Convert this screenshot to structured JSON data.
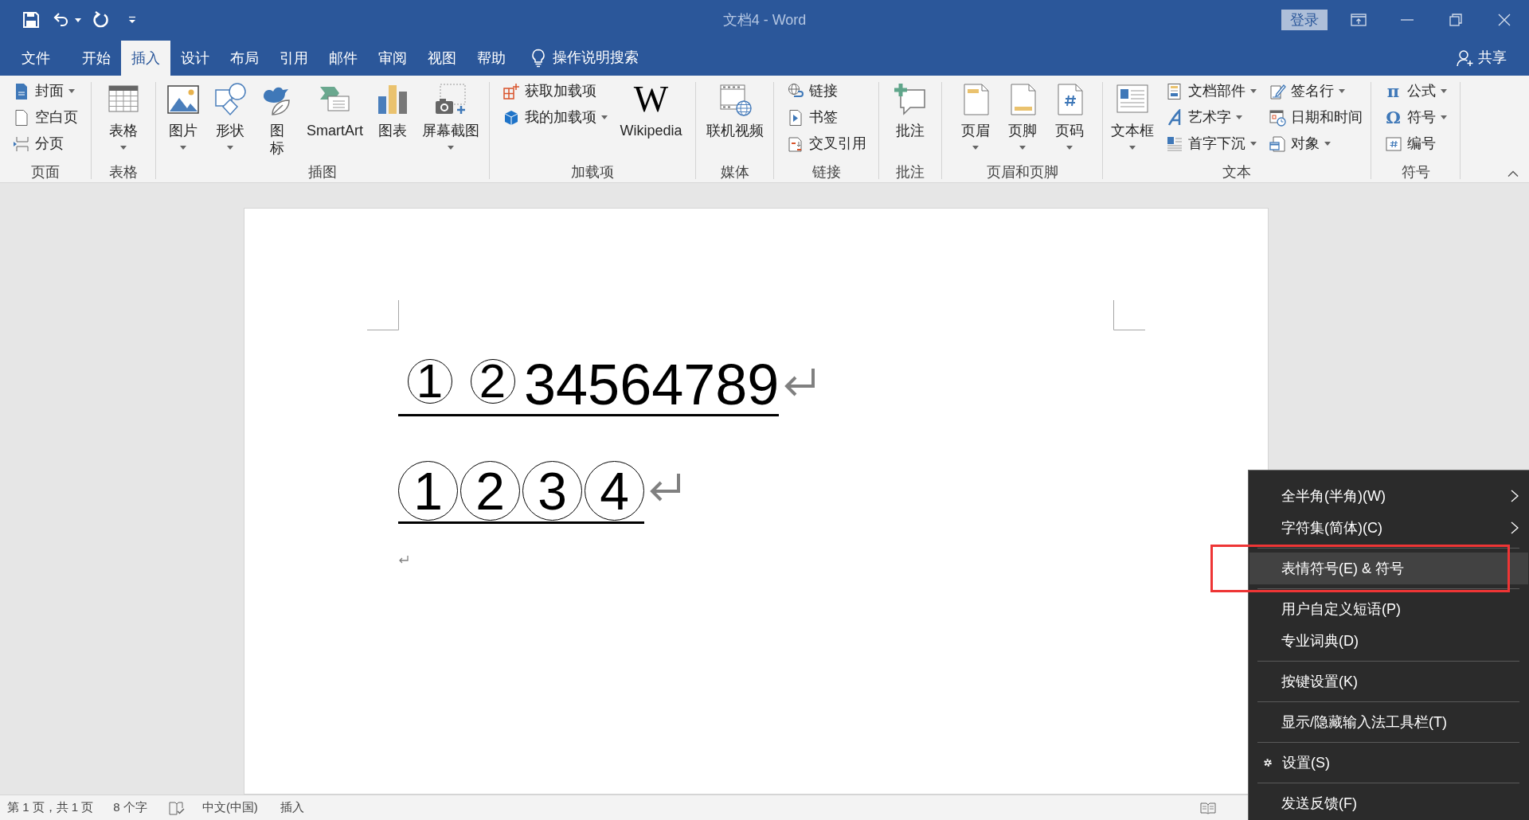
{
  "window": {
    "title": "文档4 - Word",
    "sign_in": "登录"
  },
  "tabs": [
    {
      "label": "文件",
      "selected": false
    },
    {
      "label": "开始",
      "selected": false
    },
    {
      "label": "插入",
      "selected": true
    },
    {
      "label": "设计",
      "selected": false
    },
    {
      "label": "布局",
      "selected": false
    },
    {
      "label": "引用",
      "selected": false
    },
    {
      "label": "邮件",
      "selected": false
    },
    {
      "label": "审阅",
      "selected": false
    },
    {
      "label": "视图",
      "selected": false
    },
    {
      "label": "帮助",
      "selected": false
    }
  ],
  "tell_me": {
    "placeholder": "操作说明搜索"
  },
  "share": {
    "label": "共享"
  },
  "ribbon": {
    "groups": [
      {
        "label": "页面",
        "items": [
          {
            "kind": "small",
            "label": "封面",
            "dropdown": true
          },
          {
            "kind": "small",
            "label": "空白页",
            "dropdown": false
          },
          {
            "kind": "small",
            "label": "分页",
            "dropdown": false
          }
        ]
      },
      {
        "label": "表格",
        "items": [
          {
            "kind": "large",
            "label": "表格",
            "dropdown": true
          }
        ]
      },
      {
        "label": "插图",
        "items": [
          {
            "kind": "large",
            "label": "图片",
            "dropdown": true
          },
          {
            "kind": "large",
            "label": "形状",
            "dropdown": true
          },
          {
            "kind": "vertical",
            "label": "图标",
            "dropdown": false
          },
          {
            "kind": "large",
            "label": "SmartArt",
            "dropdown": false
          },
          {
            "kind": "large",
            "label": "图表",
            "dropdown": false
          },
          {
            "kind": "large",
            "label": "屏幕截图",
            "dropdown": true
          }
        ]
      },
      {
        "label": "加载项",
        "items": [
          {
            "kind": "small",
            "label": "获取加载项",
            "dropdown": false
          },
          {
            "kind": "small",
            "label": "我的加载项",
            "dropdown": true
          },
          {
            "kind": "large",
            "label": "Wikipedia",
            "dropdown": false,
            "logo": "W"
          }
        ]
      },
      {
        "label": "媒体",
        "items": [
          {
            "kind": "large",
            "label": "联机视频",
            "dropdown": false
          }
        ]
      },
      {
        "label": "链接",
        "items": [
          {
            "kind": "small",
            "label": "链接",
            "dropdown": false
          },
          {
            "kind": "small",
            "label": "书签",
            "dropdown": false
          },
          {
            "kind": "small",
            "label": "交叉引用",
            "dropdown": false
          }
        ]
      },
      {
        "label": "批注",
        "items": [
          {
            "kind": "large",
            "label": "批注",
            "dropdown": false
          }
        ]
      },
      {
        "label": "页眉和页脚",
        "items": [
          {
            "kind": "large",
            "label": "页眉",
            "dropdown": true
          },
          {
            "kind": "large",
            "label": "页脚",
            "dropdown": true
          },
          {
            "kind": "large",
            "label": "页码",
            "dropdown": true
          }
        ]
      },
      {
        "label": "文本",
        "items": [
          {
            "kind": "large",
            "label": "文本框",
            "dropdown": true
          },
          {
            "kind": "small",
            "label": "文档部件",
            "dropdown": true
          },
          {
            "kind": "small",
            "label": "艺术字",
            "dropdown": true
          },
          {
            "kind": "small",
            "label": "首字下沉",
            "dropdown": true
          },
          {
            "kind": "small",
            "label": "签名行",
            "dropdown": true
          },
          {
            "kind": "small",
            "label": "日期和时间",
            "dropdown": false
          },
          {
            "kind": "small",
            "label": "对象",
            "dropdown": true
          }
        ]
      },
      {
        "label": "符号",
        "items": [
          {
            "kind": "small",
            "label": "公式",
            "dropdown": true,
            "glyph": "π"
          },
          {
            "kind": "small",
            "label": "符号",
            "dropdown": true,
            "glyph": "Ω"
          },
          {
            "kind": "small",
            "label": "编号",
            "dropdown": false
          }
        ]
      }
    ]
  },
  "document": {
    "paragraphs": [
      {
        "kind": "text",
        "underlined": true,
        "segments": [
          {
            "kind": "ringed-small",
            "text": "1"
          },
          {
            "kind": "ringed-small",
            "text": "2"
          },
          {
            "kind": "plain",
            "text": "34564789"
          }
        ]
      },
      {
        "kind": "text",
        "underlined": true,
        "segments": [
          {
            "kind": "ringed-large",
            "text": "1"
          },
          {
            "kind": "ringed-large",
            "text": "2"
          },
          {
            "kind": "ringed-large",
            "text": "3"
          },
          {
            "kind": "ringed-large",
            "text": "4"
          }
        ]
      },
      {
        "kind": "empty"
      }
    ]
  },
  "status_bar": {
    "page": "第 1 页，共 1 页",
    "words": "8 个字",
    "language": "中文(中国)",
    "mode": "插入"
  },
  "context_menu": {
    "items": [
      {
        "kind": "submenu",
        "label": "全半角(半角)(W)",
        "selected": false,
        "divider_after": false
      },
      {
        "kind": "submenu",
        "label": "字符集(简体)(C)",
        "selected": false,
        "divider_after": true
      },
      {
        "kind": "command",
        "label": "表情符号(E) & 符号",
        "selected": true,
        "divider_after": true
      },
      {
        "kind": "command",
        "label": "用户自定义短语(P)",
        "selected": false,
        "divider_after": false
      },
      {
        "kind": "command",
        "label": "专业词典(D)",
        "selected": false,
        "divider_after": true
      },
      {
        "kind": "command",
        "label": "按键设置(K)",
        "selected": false,
        "divider_after": true
      },
      {
        "kind": "command",
        "label": "显示/隐藏输入法工具栏(T)",
        "selected": false,
        "divider_after": true
      },
      {
        "kind": "settings",
        "label": "设置(S)",
        "selected": false,
        "divider_after": true
      },
      {
        "kind": "command",
        "label": "发送反馈(F)",
        "selected": false,
        "divider_after": false
      }
    ]
  }
}
